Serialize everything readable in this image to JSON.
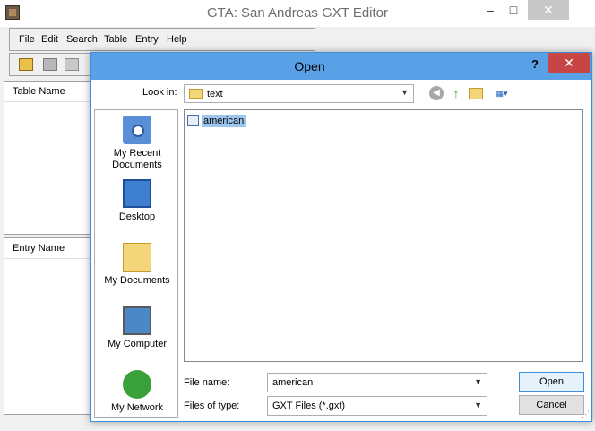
{
  "main_window": {
    "title": "GTA: San Andreas GXT Editor",
    "menu": [
      "File",
      "Edit",
      "Search",
      "Table",
      "Entry",
      "Help"
    ],
    "toolbar_icons": [
      "open-folder-icon",
      "save-icon",
      "save-as-icon"
    ],
    "panels": {
      "table_header": "Table Name",
      "entry_header": "Entry Name"
    },
    "window_controls": {
      "minimize": "–",
      "maximize": "□",
      "close": "✕"
    }
  },
  "dialog": {
    "title": "Open",
    "help": "?",
    "close": "✕",
    "look_in_label": "Look in:",
    "look_in_value": "text",
    "places": [
      {
        "label": "My Recent Documents",
        "icon": "recent-documents-icon"
      },
      {
        "label": "Desktop",
        "icon": "desktop-icon"
      },
      {
        "label": "My Documents",
        "icon": "my-documents-icon"
      },
      {
        "label": "My Computer",
        "icon": "my-computer-icon"
      },
      {
        "label": "My Network",
        "icon": "my-network-icon"
      }
    ],
    "files": [
      {
        "name": "american",
        "selected": true
      }
    ],
    "file_name_label": "File name:",
    "file_name_value": "american",
    "files_of_type_label": "Files of type:",
    "files_of_type_value": "GXT Files (*.gxt)",
    "open_button": "Open",
    "cancel_button": "Cancel"
  },
  "colors": {
    "dialog_title_bar": "#5aa0e6",
    "close_button": "#c74545",
    "selection": "#9cc6ee"
  }
}
